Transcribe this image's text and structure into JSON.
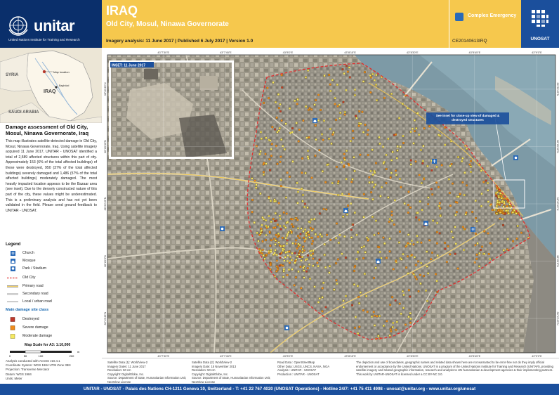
{
  "header": {
    "org_name": "unitar",
    "org_sub": "United Nations Institute for Training and Research",
    "title": "IRAQ",
    "subtitle": "Old City, Mosul, Ninawa Governorate",
    "imagery_line": "Imagery analysis: 11 June 2017 | Published 6 July 2017 | Version 1.0",
    "emergency_type": "Complex Emergency",
    "glide": "CE20140613IRQ",
    "unosat": "UNOSAT"
  },
  "locator": {
    "labels": [
      "SYRIA",
      "IRAQ",
      "SAUDI ARABIA",
      "Baghdad",
      "Map location"
    ]
  },
  "description": {
    "title": "Damage assessment of Old City, Mosul, Ninawa Governorate, Iraq",
    "body": "This map illustrates satellite-detected damage in Old City, Mosul, Ninawa Governorate, Iraq. Using satellite imagery acquired 11 June 2017, UNITAR - UNOSAT identified a total of 2,589 affected structures within this part of city. Approximately 153 (6% of the total affected buildings) of these were destroyed, 950 (37% of the total affected buildings) severely damaged and 1,486 (57% of the total affected buildings) moderately damaged. The most heavily impacted location appears to be the Bazaar area (see inset). Due to the densely constructed nature of this part of the city, these values might be underestimated. This is a preliminary analysis and has not yet been validated in the field. Please send ground feedback to UNITAR - UNOSAT."
  },
  "legend": {
    "title": "Legend",
    "items": [
      {
        "label": "Church",
        "kind": "church"
      },
      {
        "label": "Mosque",
        "kind": "mosque"
      },
      {
        "label": "Park / Stadium",
        "kind": "park"
      },
      {
        "label": "Old City",
        "kind": "oldcity"
      },
      {
        "label": "Primary road",
        "kind": "primary"
      },
      {
        "label": "Secondary road",
        "kind": "secondary"
      },
      {
        "label": "Local / urban road",
        "kind": "local"
      }
    ],
    "damage_title": "Main damage site class",
    "damage": [
      {
        "label": "Destroyed",
        "color": "#c0392b"
      },
      {
        "label": "Severe damage",
        "color": "#f08c1a"
      },
      {
        "label": "Moderate damage",
        "color": "#f5e960"
      }
    ],
    "scale_title": "Map Scale for A3: 1:10,000",
    "scale_ticks": [
      "0",
      "50",
      "100",
      "200"
    ],
    "scale_unit": "m"
  },
  "coord_info": [
    "Analysis conducted with ArcGIS v10.4.1",
    "Coordinate System: WGS 1984 UTM Zone 38N",
    "Projection: Transverse Mercator",
    "Datum: WGS 1984",
    "Units: Meter"
  ],
  "map": {
    "inset_label": "INSET: 11 June 2017",
    "callout": "See Inset for close-up view of damaged & destroyed structures",
    "lon_ticks": [
      "43°7'30\"E",
      "43°7'45\"E",
      "43°8'0\"E",
      "43°8'15\"E",
      "43°8'30\"E",
      "43°8'45\"E",
      "43°9'0\"E"
    ],
    "lat_ticks": [
      "36°20'45\"N",
      "36°20'30\"N",
      "36°20'15\"N",
      "36°20'0\"N",
      "36°19'45\"N"
    ]
  },
  "sources": {
    "col1": [
      "Satellite Data (1): WorldView-2",
      "Imagery Dates: 11 June 2017",
      "Resolution: 50 cm",
      "Copyright: DigitalGlobe, Inc.",
      "Source: Department of State, Humanitarian Information Unit;",
      "NextView License"
    ],
    "col2": [
      "Satellite Data (2): WorldView-2",
      "Imagery Date: 15 November 2013",
      "Resolution: 50 cm",
      "Copyright: DigitalGlobe, Inc.",
      "Source: Department of State, Humanitarian Information Unit;",
      "NextView License"
    ],
    "col3": [
      "Road Data : OpenStreetMap",
      "Other Data: USGS, UNCS, NASA, NGA",
      "Analysis : UNITAR - UNOSAT",
      "Production : UNITAR - UNOSAT"
    ],
    "disclaimer": "The depiction and use of boundaries, geographic names and related data shown here are not warranted to be error-free nor do they imply official endorsement or acceptance by the United Nations. UNOSAT is a program of the United Nations Institute for Training and Research (UNITAR), providing satellite imagery and related geographic information, research and analysis to UN humanitarian & development agencies & their implementing partners. This work by UNITAR-UNOSAT is licensed under a CC BY-NC 3.0."
  },
  "footer": "UNITAR - UNOSAT - Palais des Nations CH-1211 Geneva 10, Switzerland - T: +41 22 767 4020 (UNOSAT Operations) - Hotline 24/7: +41 75 411 4998 - unosat@unitar.org - www.unitar.org/unosat",
  "colors": {
    "header_band": "#f6c84d",
    "brand_blue": "#1b4f9c",
    "destroyed": "#c0392b",
    "severe": "#f08c1a",
    "moderate": "#f5e960",
    "old_city_boundary": "#e03030"
  }
}
